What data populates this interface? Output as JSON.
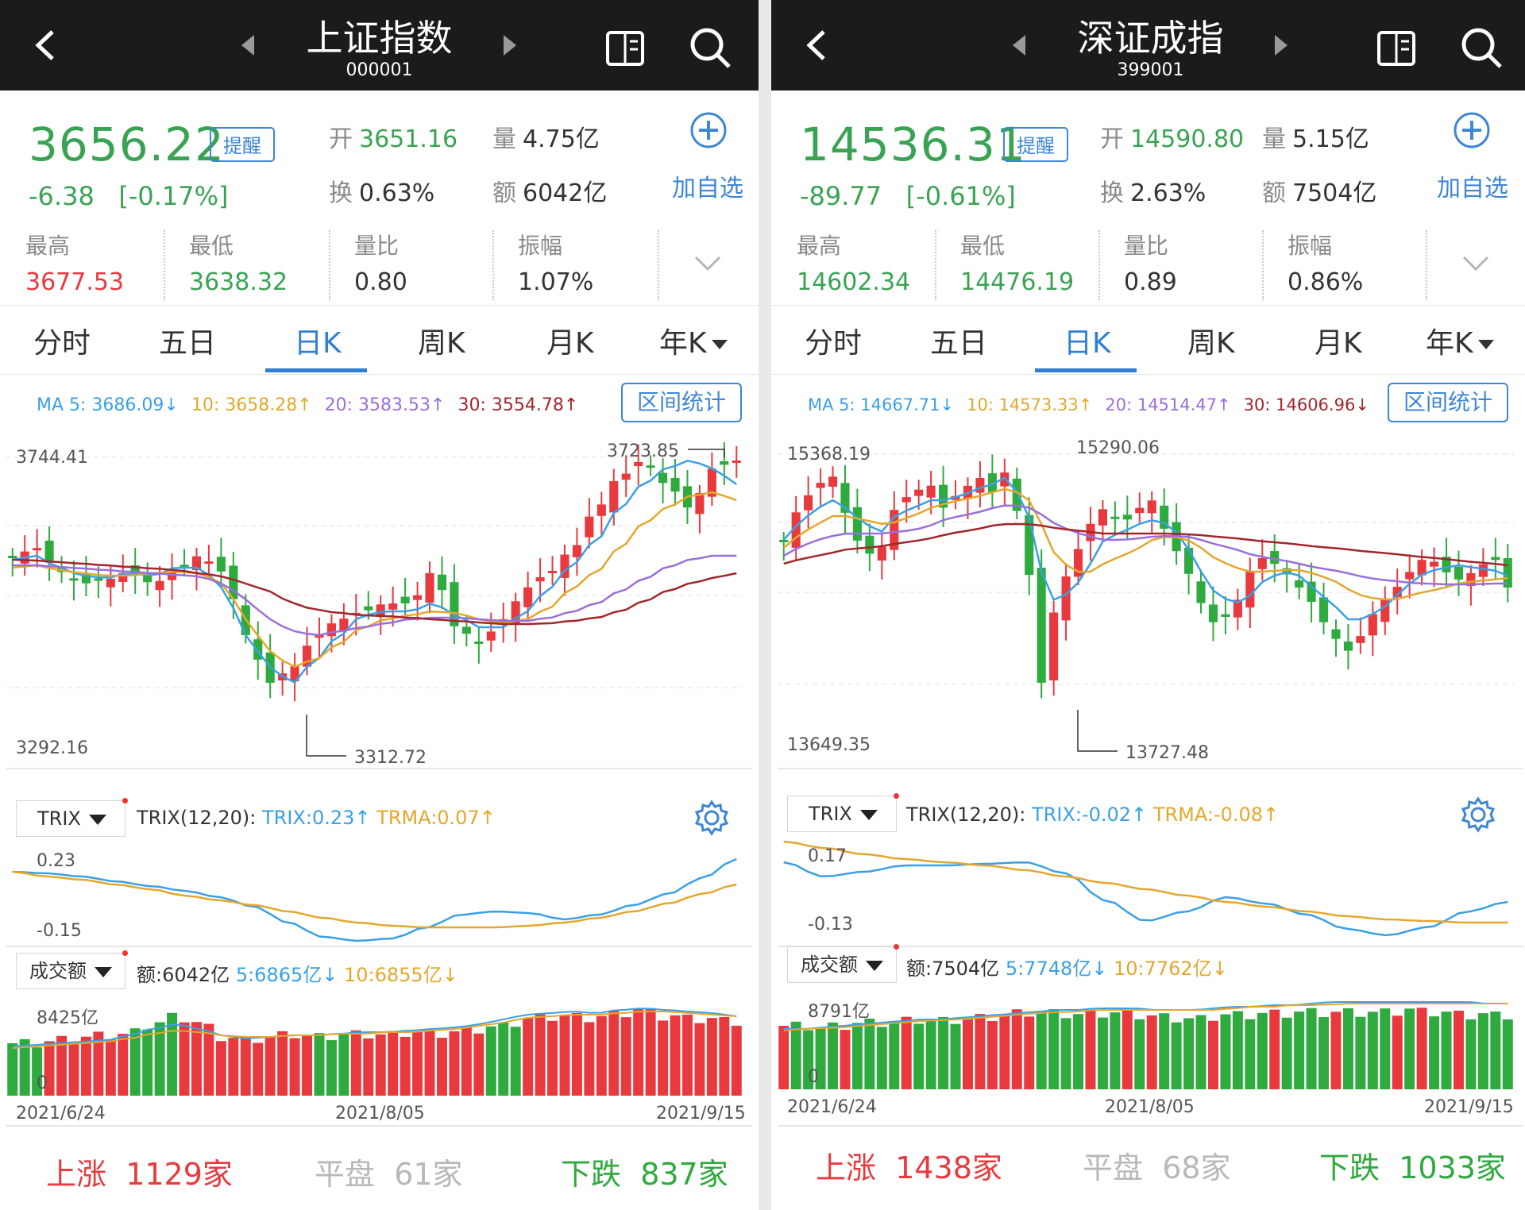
{
  "colors": {
    "up": "#e83a3e",
    "down": "#2eaa3e",
    "ma5": "#3aa0e6",
    "ma10": "#e4a72c",
    "ma20": "#9a6fdc",
    "ma30": "#a2262c",
    "accent": "#2f7fd3"
  },
  "left": {
    "header": {
      "title": "上证指数",
      "code": "000001"
    },
    "quote": {
      "price": "3656.22",
      "remind": "提醒",
      "change": "-6.38",
      "change_pct": "[-0.17%]",
      "open_k": "开",
      "open_v": "3651.16",
      "vol_k": "量",
      "vol_v": "4.75亿",
      "turn_k": "换",
      "turn_v": "0.63%",
      "amt_k": "额",
      "amt_v": "6042亿",
      "add_label": "加自选",
      "high_k": "最高",
      "high_v": "3677.53",
      "low_k": "最低",
      "low_v": "3638.32",
      "ratio_k": "量比",
      "ratio_v": "0.80",
      "amp_k": "振幅",
      "amp_v": "1.07%"
    },
    "tabs": [
      "分时",
      "五日",
      "日K",
      "周K",
      "月K",
      "年K"
    ],
    "ma": {
      "ma5": "MA 5: 3686.09↓",
      "ma10": "10: 3658.28↑",
      "ma20": "20: 3583.53↑",
      "ma30": "30: 3554.78↑",
      "range_btn": "区间统计"
    },
    "kline": {
      "ymax_label": "3744.41",
      "ymin_label": "3292.16",
      "hi_label": "3723.85",
      "lo_label": "3312.72"
    },
    "trix": {
      "select": "TRIX",
      "params": "TRIX(12,20):",
      "trix": "TRIX:0.23↑",
      "trma": "TRMA:0.07↑",
      "y_top": "0.23",
      "y_bot": "-0.15"
    },
    "turnover": {
      "select": "成交额",
      "amt": "额:6042亿",
      "ma5": "5:6865亿↓",
      "ma10": "10:6855亿↓",
      "y_top": "8425亿",
      "zero": "0"
    },
    "dates": [
      "2021/6/24",
      "2021/8/05",
      "2021/9/15"
    ],
    "breadth": {
      "up_k": "上涨",
      "up_v": "1129家",
      "flat_k": "平盘",
      "flat_v": "61家",
      "down_k": "下跌",
      "down_v": "837家"
    }
  },
  "right": {
    "header": {
      "title": "深证成指",
      "code": "399001"
    },
    "quote": {
      "price": "14536.31",
      "remind": "提醒",
      "change": "-89.77",
      "change_pct": "[-0.61%]",
      "open_k": "开",
      "open_v": "14590.80",
      "vol_k": "量",
      "vol_v": "5.15亿",
      "turn_k": "换",
      "turn_v": "2.63%",
      "amt_k": "额",
      "amt_v": "7504亿",
      "add_label": "加自选",
      "high_k": "最高",
      "high_v": "14602.34",
      "low_k": "最低",
      "low_v": "14476.19",
      "ratio_k": "量比",
      "ratio_v": "0.89",
      "amp_k": "振幅",
      "amp_v": "0.86%"
    },
    "tabs": [
      "分时",
      "五日",
      "日K",
      "周K",
      "月K",
      "年K"
    ],
    "ma": {
      "ma5": "MA 5: 14667.71↓",
      "ma10": "10: 14573.33↑",
      "ma20": "20: 14514.47↑",
      "ma30": "30: 14606.96↓",
      "range_btn": "区间统计"
    },
    "kline": {
      "ymax_label": "15368.19",
      "ymin_label": "13649.35",
      "hi_label": "15290.06",
      "lo_label": "13727.48"
    },
    "trix": {
      "select": "TRIX",
      "params": "TRIX(12,20):",
      "trix": "TRIX:-0.02↑",
      "trma": "TRMA:-0.08↑",
      "y_top": "0.17",
      "y_bot": "-0.13"
    },
    "turnover": {
      "select": "成交额",
      "amt": "额:7504亿",
      "ma5": "5:7748亿↓",
      "ma10": "10:7762亿↓",
      "y_top": "8791亿",
      "zero": "0"
    },
    "dates": [
      "2021/6/24",
      "2021/8/05",
      "2021/9/15"
    ],
    "breadth": {
      "up_k": "上涨",
      "up_v": "1438家",
      "flat_k": "平盘",
      "flat_v": "68家",
      "down_k": "下跌",
      "down_v": "1033家"
    }
  }
}
